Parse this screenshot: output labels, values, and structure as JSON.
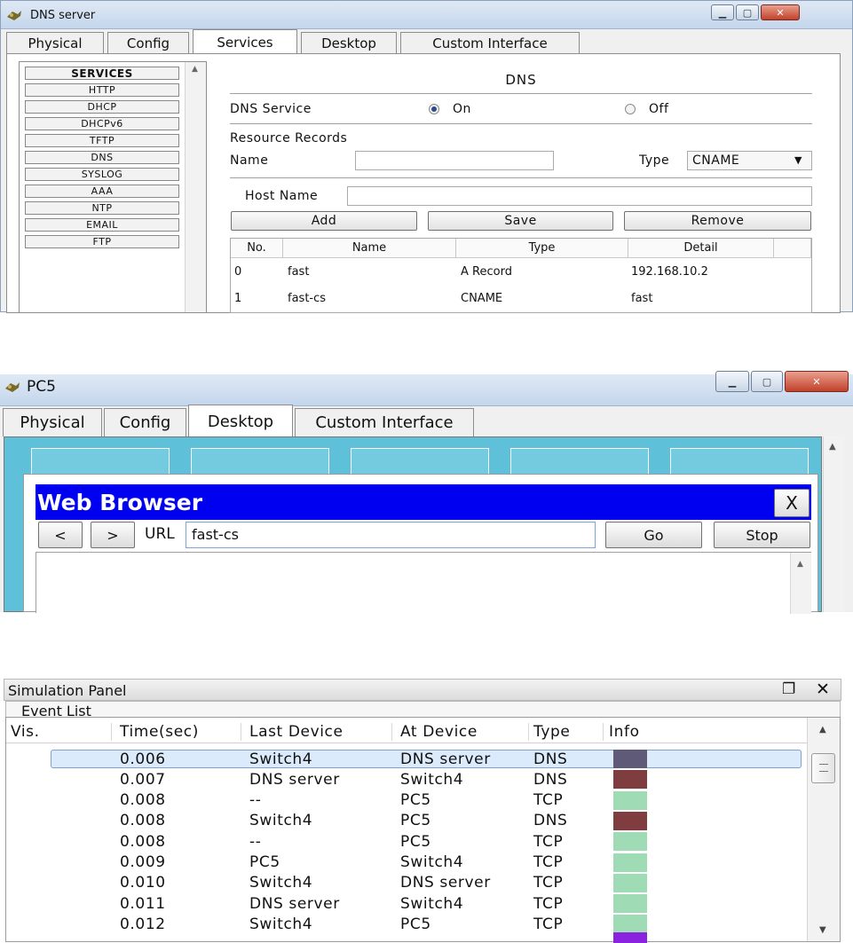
{
  "dns_window": {
    "title": "DNS server",
    "tabs": [
      "Physical",
      "Config",
      "Services",
      "Desktop",
      "Custom Interface"
    ],
    "active_tab": "Services",
    "services": [
      "SERVICES",
      "HTTP",
      "DHCP",
      "DHCPv6",
      "TFTP",
      "DNS",
      "SYSLOG",
      "AAA",
      "NTP",
      "EMAIL",
      "FTP"
    ],
    "panel_title": "DNS",
    "dns_service_label": "DNS Service",
    "on_label": "On",
    "off_label": "Off",
    "dns_service_state": "On",
    "resource_records_label": "Resource Records",
    "name_label": "Name",
    "name_value": "",
    "type_label": "Type",
    "type_value": "CNAME",
    "host_name_label": "Host Name",
    "host_name_value": "",
    "add_label": "Add",
    "save_label": "Save",
    "remove_label": "Remove",
    "table": {
      "headers": [
        "No.",
        "Name",
        "Type",
        "Detail"
      ],
      "rows": [
        [
          "0",
          "fast",
          "A Record",
          "192.168.10.2"
        ],
        [
          "1",
          "fast-cs",
          "CNAME",
          "fast"
        ]
      ]
    }
  },
  "pc_window": {
    "title": "PC5",
    "tabs": [
      "Physical",
      "Config",
      "Desktop",
      "Custom Interface"
    ],
    "active_tab": "Desktop",
    "browser": {
      "title": "Web Browser",
      "close_label": "X",
      "back_label": "<",
      "forward_label": ">",
      "url_label": "URL",
      "url_value": "fast-cs",
      "go_label": "Go",
      "stop_label": "Stop"
    }
  },
  "simulation_panel": {
    "title": "Simulation Panel",
    "section": "Event List",
    "headers": [
      "Vis.",
      "Time(sec)",
      "Last Device",
      "At Device",
      "Type",
      "Info"
    ],
    "events": [
      {
        "time": "0.006",
        "last": "Switch4",
        "at": "DNS server",
        "type": "DNS",
        "color": "#5f5a77",
        "selected": true
      },
      {
        "time": "0.007",
        "last": "DNS server",
        "at": "Switch4",
        "type": "DNS",
        "color": "#7f3d40",
        "selected": false
      },
      {
        "time": "0.008",
        "last": "--",
        "at": "PC5",
        "type": "TCP",
        "color": "#9fdbb4",
        "selected": false
      },
      {
        "time": "0.008",
        "last": "Switch4",
        "at": "PC5",
        "type": "DNS",
        "color": "#7f3d40",
        "selected": false
      },
      {
        "time": "0.008",
        "last": "--",
        "at": "PC5",
        "type": "TCP",
        "color": "#9fdbb4",
        "selected": false
      },
      {
        "time": "0.009",
        "last": "PC5",
        "at": "Switch4",
        "type": "TCP",
        "color": "#9fdbb4",
        "selected": false
      },
      {
        "time": "0.010",
        "last": "Switch4",
        "at": "DNS server",
        "type": "TCP",
        "color": "#9fdbb4",
        "selected": false
      },
      {
        "time": "0.011",
        "last": "DNS server",
        "at": "Switch4",
        "type": "TCP",
        "color": "#9fdbb4",
        "selected": false
      },
      {
        "time": "0.012",
        "last": "Switch4",
        "at": "PC5",
        "type": "TCP",
        "color": "#9fdbb4",
        "selected": false
      }
    ],
    "selection_color": "#dcebfc",
    "partial_row_color": "#8a22e0"
  }
}
